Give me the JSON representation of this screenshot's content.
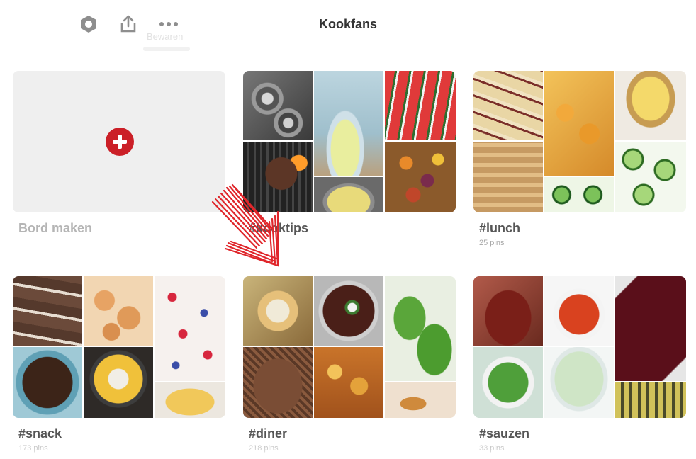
{
  "header": {
    "title": "Kookfans",
    "ghost_labels": [
      "",
      "Bewaren"
    ],
    "icons": [
      "settings-hexagon-icon",
      "share-icon",
      "more-icon"
    ]
  },
  "boards": [
    {
      "name": "Bord maken",
      "count": ""
    },
    {
      "name": "#kooktips",
      "count": ""
    },
    {
      "name": "#lunch",
      "count": "25 pins"
    },
    {
      "name": "#snack",
      "count": "173 pins"
    },
    {
      "name": "#diner",
      "count": "218 pins"
    },
    {
      "name": "#sauzen",
      "count": "33 pins"
    }
  ],
  "colors": {
    "brand_red": "#cb1f27",
    "create_bg": "#efefef",
    "arrow_red": "#e0262b"
  }
}
